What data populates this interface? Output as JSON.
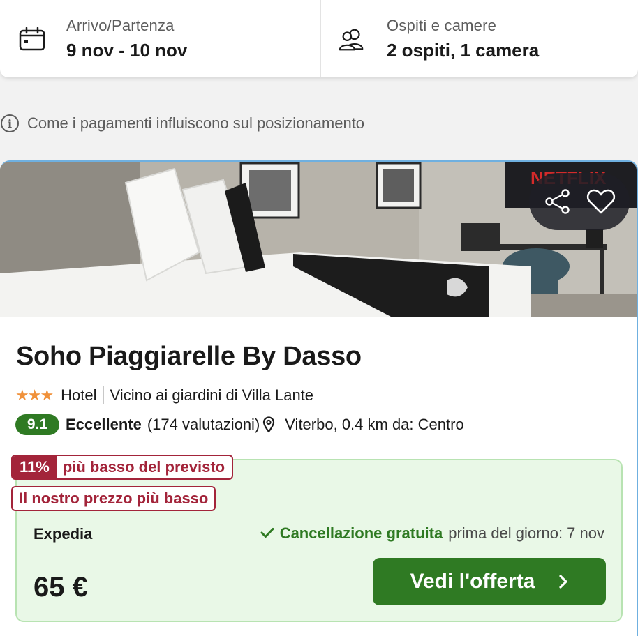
{
  "search": {
    "dates_label": "Arrivo/Partenza",
    "dates_value": "9 nov - 10 nov",
    "guests_label": "Ospiti e camere",
    "guests_value": "2 ospiti, 1 camera"
  },
  "info": {
    "text": "Come i pagamenti influiscono sul posizionamento"
  },
  "hotel": {
    "photo_tv_text": "NETFLIX",
    "name": "Soho Piaggiarelle By Dasso",
    "stars": "★★★",
    "star_count": 3,
    "type": "Hotel",
    "nearby": "Vicino ai giardini di Villa Lante",
    "rating_score": "9.1",
    "rating_word": "Eccellente",
    "rating_count": "(174 valutazioni)",
    "location": "Viterbo, 0.4 km da: Centro"
  },
  "deal": {
    "percent": "11%",
    "percent_text": "più basso del previsto",
    "lowest_tag": "Il nostro prezzo più basso",
    "provider": "Expedia",
    "cancel_strong": "Cancellazione gratuita",
    "cancel_rest": "prima del giorno: 7 nov",
    "price": "65 €",
    "cta_label": "Vedi l'offerta"
  },
  "icons": {
    "calendar": "calendar-icon",
    "guests": "users-icon",
    "info": "info-icon",
    "share": "share-icon",
    "favorite": "heart-icon",
    "pin": "map-pin-icon",
    "check": "check-icon",
    "chevron": "chevron-right-icon"
  },
  "colors": {
    "rating_green": "#2f7a23",
    "deal_red": "#a3243a",
    "stars_orange": "#f0913a",
    "deal_bg": "#e9f8e7"
  }
}
